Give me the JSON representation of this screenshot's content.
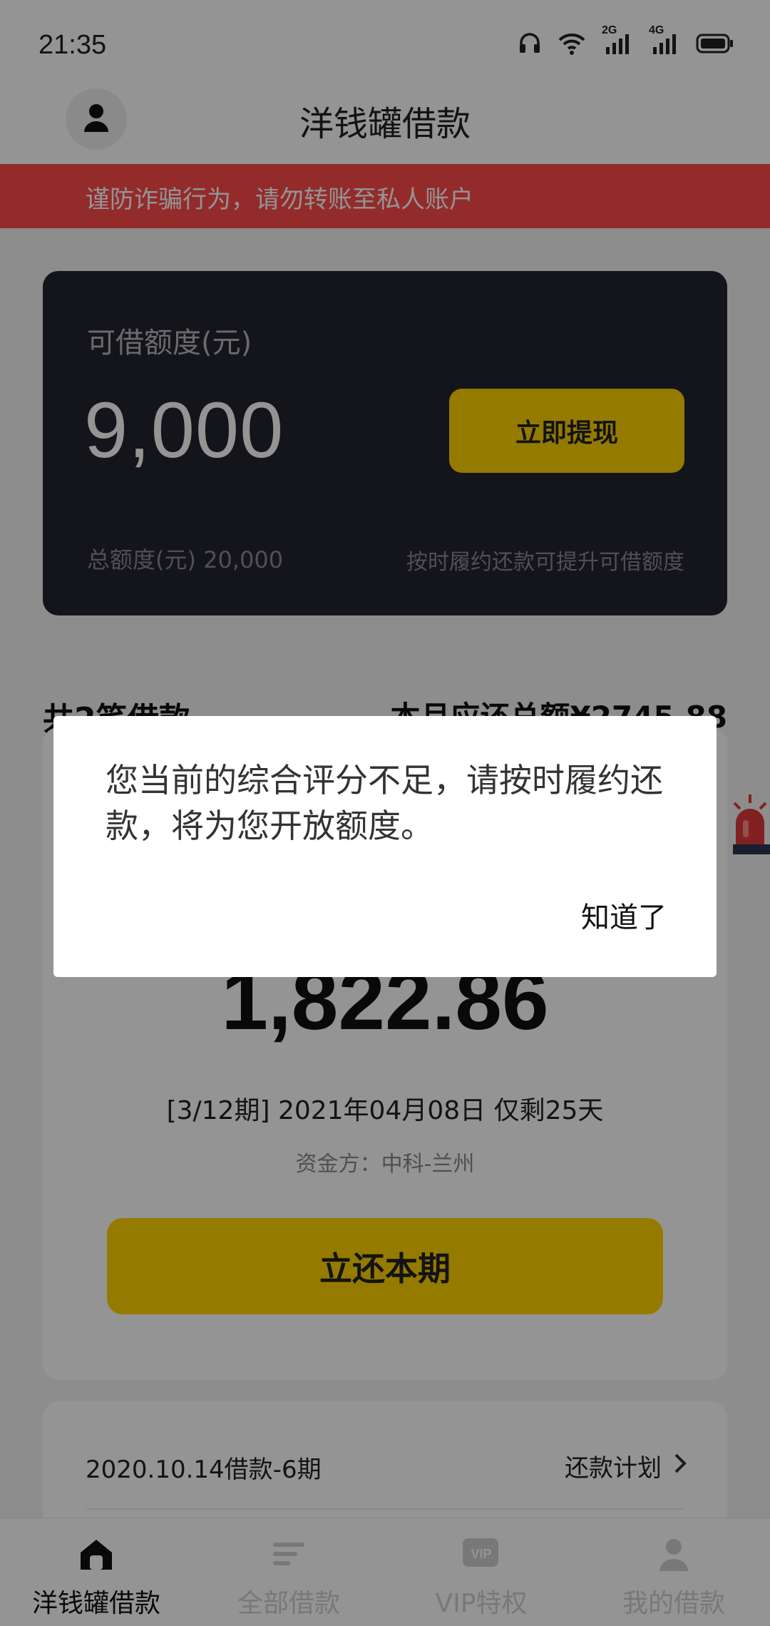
{
  "status_bar": {
    "time": "21:35",
    "icons": [
      "headset-icon",
      "wifi-icon",
      "signal-2g-icon",
      "signal-4g-icon",
      "battery-icon"
    ],
    "network_labels": [
      "2G",
      "4G"
    ]
  },
  "header": {
    "title": "洋钱罐借款",
    "avatar_icon": "user-icon"
  },
  "warning": {
    "text": "谨防诈骗行为，请勿转账至私人账户",
    "color": "#ff4b4b"
  },
  "credit": {
    "label": "可借额度(元)",
    "amount": "9,000",
    "withdraw_label": "立即提现",
    "total_text": "总额度(元) 20,000",
    "hint": "按时履约还款可提升可借额度",
    "accent": "#ffd400"
  },
  "loans": {
    "count_text": "共2笔借款",
    "month_total_text": "本月应还总额¥2745.88"
  },
  "repayment": {
    "amount": "1,822.86",
    "period_text": "[3/12期] 2021年04月08日 仅剩25天",
    "funder_text": "资金方：中科-兰州",
    "button_label": "立还本期"
  },
  "loan_item": {
    "name": "2020.10.14借款-6期",
    "plan_label": "还款计划"
  },
  "bottom_nav": {
    "items": [
      {
        "label": "洋钱罐借款",
        "icon": "home-icon",
        "active": true
      },
      {
        "label": "全部借款",
        "icon": "list-icon",
        "active": false
      },
      {
        "label": "VIP特权",
        "icon": "vip-icon",
        "active": false,
        "icon_text": "VIP"
      },
      {
        "label": "我的借款",
        "icon": "user-icon",
        "active": false
      }
    ]
  },
  "dialog": {
    "message": "您当前的综合评分不足，请按时履约还款，将为您开放额度。",
    "ok_label": "知道了"
  }
}
